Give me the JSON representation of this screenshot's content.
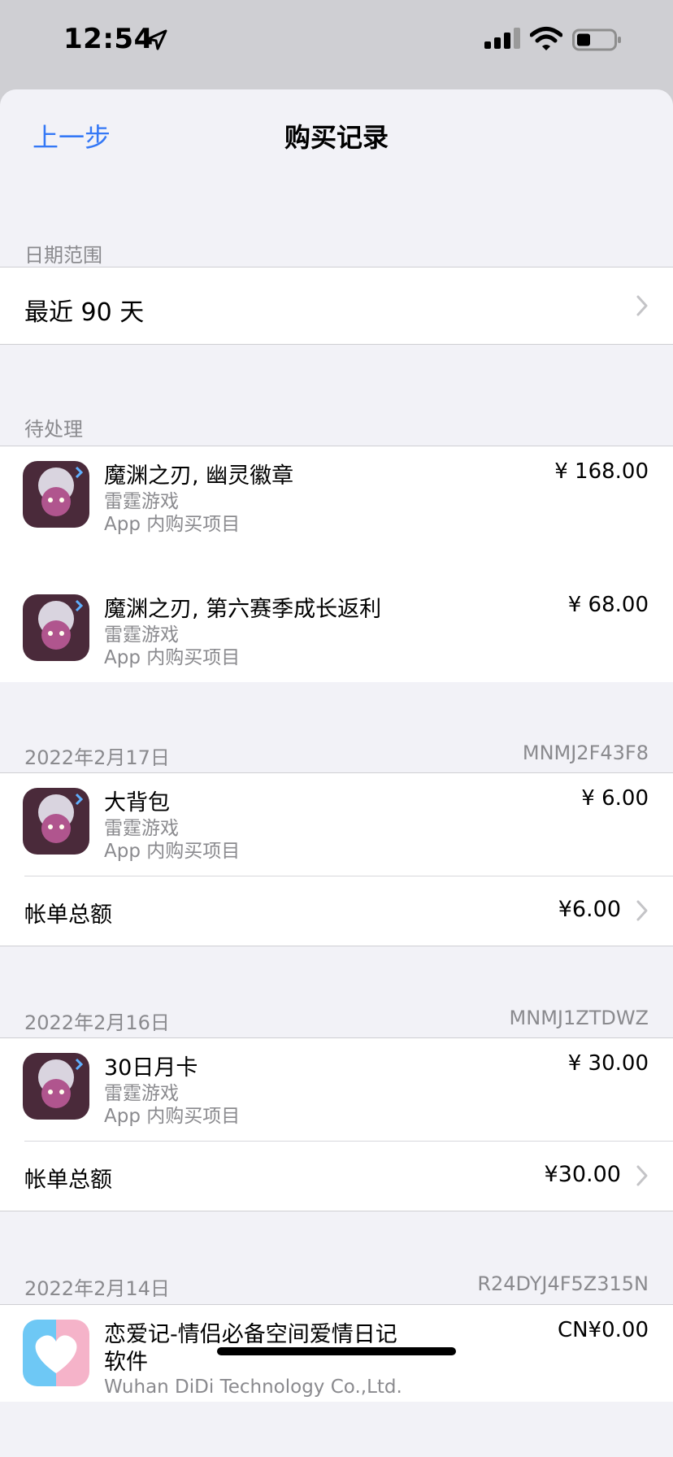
{
  "status_bar": {
    "time": "12:54"
  },
  "nav": {
    "back_label": "上一步",
    "title": "购买记录"
  },
  "date_range": {
    "header": "日期范围",
    "value": "最近 90 天"
  },
  "pending": {
    "header": "待处理",
    "items": [
      {
        "title": "魔渊之刃, 幽灵徽章",
        "developer": "雷霆游戏",
        "type": "App 内购买项目",
        "price": "¥ 168.00",
        "icon": "game-icon"
      },
      {
        "title": "魔渊之刃, 第六赛季成长返利",
        "developer": "雷霆游戏",
        "type": "App 内购买项目",
        "price": "¥ 68.00",
        "icon": "game-icon"
      }
    ]
  },
  "orders": [
    {
      "date": "2022年2月17日",
      "order_id": "MNMJ2F43F8",
      "items": [
        {
          "title": "大背包",
          "developer": "雷霆游戏",
          "type": "App 内购买项目",
          "price": "¥ 6.00",
          "icon": "game-icon"
        }
      ],
      "total_label": "帐单总额",
      "total_value": "¥6.00"
    },
    {
      "date": "2022年2月16日",
      "order_id": "MNMJ1ZTDWZ",
      "items": [
        {
          "title": "30日月卡",
          "developer": "雷霆游戏",
          "type": "App 内购买项目",
          "price": "¥ 30.00",
          "icon": "game-icon"
        }
      ],
      "total_label": "帐单总额",
      "total_value": "¥30.00"
    },
    {
      "date": "2022年2月14日",
      "order_id": "R24DYJ4F5Z315N",
      "items": [
        {
          "title_line1": "恋爱记-情侣必备空间爱情日记",
          "title_line2": "软件",
          "developer": "Wuhan DiDi Technology Co.,Ltd.",
          "price": "CN¥0.00",
          "icon": "heart-app-icon"
        }
      ]
    }
  ],
  "colors": {
    "accent": "#3478f6",
    "secondary_text": "#8a8a8e",
    "background": "#f2f2f7"
  }
}
